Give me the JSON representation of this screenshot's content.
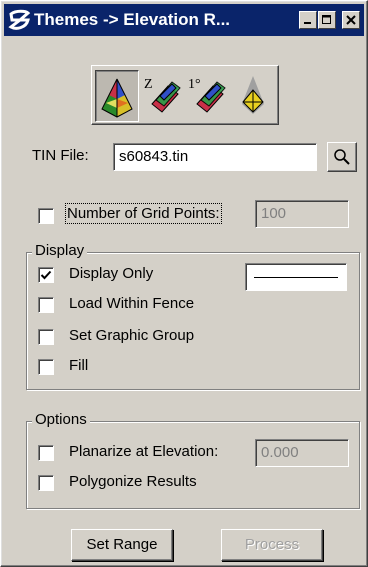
{
  "window": {
    "title": "Themes -> Elevation R...",
    "controls": [
      "minimize",
      "maximize",
      "close"
    ]
  },
  "toolbar": {
    "tools": [
      {
        "name": "elevation-tool",
        "active": true
      },
      {
        "name": "z-slope-tool",
        "glyph": "Z",
        "active": false
      },
      {
        "name": "degree-slope-tool",
        "glyph": "1°",
        "active": false
      },
      {
        "name": "aspect-tool",
        "active": false
      }
    ]
  },
  "tin": {
    "label": "TIN File:",
    "value": "s60843.tin"
  },
  "grid": {
    "checked": false,
    "label": "Number of Grid Points:",
    "value": "100"
  },
  "display": {
    "title": "Display",
    "items": [
      {
        "label": "Display Only",
        "checked": true
      },
      {
        "label": "Load Within Fence",
        "checked": false
      },
      {
        "label": "Set Graphic Group",
        "checked": false
      },
      {
        "label": "Fill",
        "checked": false
      }
    ]
  },
  "options": {
    "title": "Options",
    "planarize": {
      "label": "Planarize at Elevation:",
      "checked": false,
      "value": "0.000"
    },
    "polygonize": {
      "label": "Polygonize Results",
      "checked": false
    }
  },
  "buttons": {
    "set_range": "Set Range",
    "process": "Process"
  },
  "colors": {
    "face": "#d4d0c8",
    "titlebar": "#0a246a",
    "disabled_text": "#808080"
  }
}
